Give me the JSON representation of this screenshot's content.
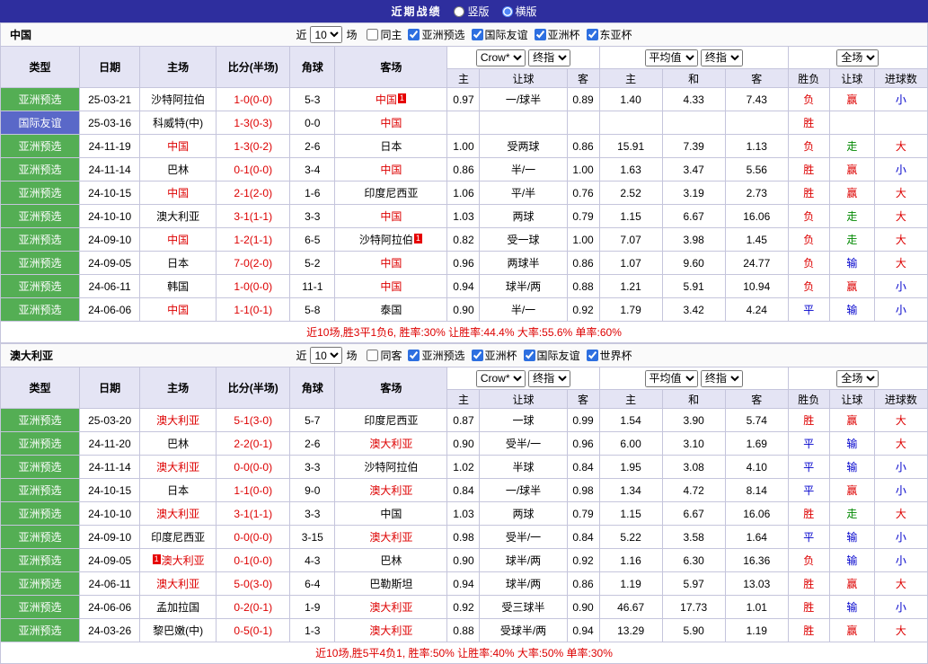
{
  "title_bar": {
    "title": "近期战绩",
    "layout_options": [
      {
        "label": "竖版",
        "selected": false
      },
      {
        "label": "横版",
        "selected": true
      }
    ]
  },
  "table_header": {
    "main_cols": [
      "类型",
      "日期",
      "主场",
      "比分(半场)",
      "角球",
      "客场"
    ],
    "odds_dropdown1": "Crow*",
    "odds_dropdown2": "终指",
    "avg_dropdown1": "平均值",
    "avg_dropdown2": "终指",
    "scope_dropdown": "全场",
    "odds_sub_cols": [
      "主",
      "让球",
      "客"
    ],
    "avg_sub_cols": [
      "主",
      "和",
      "客"
    ],
    "result_sub_cols": [
      "胜负",
      "让球",
      "进球数"
    ]
  },
  "colors": {
    "title_bar_bg": "#2e2e9e",
    "header_bg": "#e4e4f4",
    "type_green": "#54ae54",
    "type_blue": "#5a68c8",
    "red": "#dd0000",
    "blue": "#0000cc",
    "green": "#008800",
    "border": "#c5c5dc"
  },
  "sections": [
    {
      "name": "中国",
      "filter": {
        "near_label": "近",
        "count": "10",
        "unit_label": "场",
        "checkboxes": [
          {
            "label": "同主",
            "checked": false
          },
          {
            "label": "亚洲预选",
            "checked": true
          },
          {
            "label": "国际友谊",
            "checked": true
          },
          {
            "label": "亚洲杯",
            "checked": true
          },
          {
            "label": "东亚杯",
            "checked": true
          }
        ]
      },
      "rows": [
        {
          "type": "亚洲预选",
          "type_style": "green",
          "date": "25-03-21",
          "home": "沙特阿拉伯",
          "home_focus": false,
          "score": "1-0(0-0)",
          "corner": "5-3",
          "away": "中国",
          "away_focus": true,
          "away_card": "1",
          "odds": [
            "0.97",
            "一/球半",
            "0.89"
          ],
          "avg": [
            "1.40",
            "4.33",
            "7.43"
          ],
          "results": [
            "负",
            "赢",
            "小"
          ]
        },
        {
          "type": "国际友谊",
          "type_style": "blue",
          "date": "25-03-16",
          "home": "科威特(中)",
          "home_focus": false,
          "score": "1-3(0-3)",
          "corner": "0-0",
          "away": "中国",
          "away_focus": true,
          "odds": [
            "",
            "",
            ""
          ],
          "avg": [
            "",
            "",
            ""
          ],
          "results": [
            "胜",
            "",
            ""
          ]
        },
        {
          "type": "亚洲预选",
          "type_style": "green",
          "date": "24-11-19",
          "home": "中国",
          "home_focus": true,
          "score": "1-3(0-2)",
          "corner": "2-6",
          "away": "日本",
          "away_focus": false,
          "odds": [
            "1.00",
            "受两球",
            "0.86"
          ],
          "avg": [
            "15.91",
            "7.39",
            "1.13"
          ],
          "results": [
            "负",
            "走",
            "大"
          ]
        },
        {
          "type": "亚洲预选",
          "type_style": "green",
          "date": "24-11-14",
          "home": "巴林",
          "home_focus": false,
          "score": "0-1(0-0)",
          "corner": "3-4",
          "away": "中国",
          "away_focus": true,
          "odds": [
            "0.86",
            "半/一",
            "1.00"
          ],
          "avg": [
            "1.63",
            "3.47",
            "5.56"
          ],
          "results": [
            "胜",
            "赢",
            "小"
          ]
        },
        {
          "type": "亚洲预选",
          "type_style": "green",
          "date": "24-10-15",
          "home": "中国",
          "home_focus": true,
          "score": "2-1(2-0)",
          "corner": "1-6",
          "away": "印度尼西亚",
          "away_focus": false,
          "odds": [
            "1.06",
            "平/半",
            "0.76"
          ],
          "avg": [
            "2.52",
            "3.19",
            "2.73"
          ],
          "results": [
            "胜",
            "赢",
            "大"
          ]
        },
        {
          "type": "亚洲预选",
          "type_style": "green",
          "date": "24-10-10",
          "home": "澳大利亚",
          "home_focus": false,
          "score": "3-1(1-1)",
          "corner": "3-3",
          "away": "中国",
          "away_focus": true,
          "odds": [
            "1.03",
            "两球",
            "0.79"
          ],
          "avg": [
            "1.15",
            "6.67",
            "16.06"
          ],
          "results": [
            "负",
            "走",
            "大"
          ]
        },
        {
          "type": "亚洲预选",
          "type_style": "green",
          "date": "24-09-10",
          "home": "中国",
          "home_focus": true,
          "score": "1-2(1-1)",
          "corner": "6-5",
          "away": "沙特阿拉伯",
          "away_focus": false,
          "away_card": "1",
          "odds": [
            "0.82",
            "受一球",
            "1.00"
          ],
          "avg": [
            "7.07",
            "3.98",
            "1.45"
          ],
          "results": [
            "负",
            "走",
            "大"
          ]
        },
        {
          "type": "亚洲预选",
          "type_style": "green",
          "date": "24-09-05",
          "home": "日本",
          "home_focus": false,
          "score": "7-0(2-0)",
          "corner": "5-2",
          "away": "中国",
          "away_focus": true,
          "odds": [
            "0.96",
            "两球半",
            "0.86"
          ],
          "avg": [
            "1.07",
            "9.60",
            "24.77"
          ],
          "results": [
            "负",
            "输",
            "大"
          ]
        },
        {
          "type": "亚洲预选",
          "type_style": "green",
          "date": "24-06-11",
          "home": "韩国",
          "home_focus": false,
          "score": "1-0(0-0)",
          "corner": "11-1",
          "away": "中国",
          "away_focus": true,
          "odds": [
            "0.94",
            "球半/两",
            "0.88"
          ],
          "avg": [
            "1.21",
            "5.91",
            "10.94"
          ],
          "results": [
            "负",
            "赢",
            "小"
          ]
        },
        {
          "type": "亚洲预选",
          "type_style": "green",
          "date": "24-06-06",
          "home": "中国",
          "home_focus": true,
          "score": "1-1(0-1)",
          "corner": "5-8",
          "away": "泰国",
          "away_focus": false,
          "odds": [
            "0.90",
            "半/一",
            "0.92"
          ],
          "avg": [
            "1.79",
            "3.42",
            "4.24"
          ],
          "results": [
            "平",
            "输",
            "小"
          ]
        }
      ],
      "summary": "近10场,胜3平1负6, 胜率:30% 让胜率:44.4% 大率:55.6% 单率:60%"
    },
    {
      "name": "澳大利亚",
      "filter": {
        "near_label": "近",
        "count": "10",
        "unit_label": "场",
        "checkboxes": [
          {
            "label": "同客",
            "checked": false
          },
          {
            "label": "亚洲预选",
            "checked": true
          },
          {
            "label": "亚洲杯",
            "checked": true
          },
          {
            "label": "国际友谊",
            "checked": true
          },
          {
            "label": "世界杯",
            "checked": true
          }
        ]
      },
      "rows": [
        {
          "type": "亚洲预选",
          "type_style": "green",
          "date": "25-03-20",
          "home": "澳大利亚",
          "home_focus": true,
          "score": "5-1(3-0)",
          "corner": "5-7",
          "away": "印度尼西亚",
          "away_focus": false,
          "odds": [
            "0.87",
            "一球",
            "0.99"
          ],
          "avg": [
            "1.54",
            "3.90",
            "5.74"
          ],
          "results": [
            "胜",
            "赢",
            "大"
          ]
        },
        {
          "type": "亚洲预选",
          "type_style": "green",
          "date": "24-11-20",
          "home": "巴林",
          "home_focus": false,
          "score": "2-2(0-1)",
          "corner": "2-6",
          "away": "澳大利亚",
          "away_focus": true,
          "odds": [
            "0.90",
            "受半/一",
            "0.96"
          ],
          "avg": [
            "6.00",
            "3.10",
            "1.69"
          ],
          "results": [
            "平",
            "输",
            "大"
          ]
        },
        {
          "type": "亚洲预选",
          "type_style": "green",
          "date": "24-11-14",
          "home": "澳大利亚",
          "home_focus": true,
          "score": "0-0(0-0)",
          "corner": "3-3",
          "away": "沙特阿拉伯",
          "away_focus": false,
          "odds": [
            "1.02",
            "半球",
            "0.84"
          ],
          "avg": [
            "1.95",
            "3.08",
            "4.10"
          ],
          "results": [
            "平",
            "输",
            "小"
          ]
        },
        {
          "type": "亚洲预选",
          "type_style": "green",
          "date": "24-10-15",
          "home": "日本",
          "home_focus": false,
          "score": "1-1(0-0)",
          "corner": "9-0",
          "away": "澳大利亚",
          "away_focus": true,
          "odds": [
            "0.84",
            "一/球半",
            "0.98"
          ],
          "avg": [
            "1.34",
            "4.72",
            "8.14"
          ],
          "results": [
            "平",
            "赢",
            "小"
          ]
        },
        {
          "type": "亚洲预选",
          "type_style": "green",
          "date": "24-10-10",
          "home": "澳大利亚",
          "home_focus": true,
          "score": "3-1(1-1)",
          "corner": "3-3",
          "away": "中国",
          "away_focus": false,
          "odds": [
            "1.03",
            "两球",
            "0.79"
          ],
          "avg": [
            "1.15",
            "6.67",
            "16.06"
          ],
          "results": [
            "胜",
            "走",
            "大"
          ]
        },
        {
          "type": "亚洲预选",
          "type_style": "green",
          "date": "24-09-10",
          "home": "印度尼西亚",
          "home_focus": false,
          "score": "0-0(0-0)",
          "corner": "3-15",
          "away": "澳大利亚",
          "away_focus": true,
          "odds": [
            "0.98",
            "受半/一",
            "0.84"
          ],
          "avg": [
            "5.22",
            "3.58",
            "1.64"
          ],
          "results": [
            "平",
            "输",
            "小"
          ]
        },
        {
          "type": "亚洲预选",
          "type_style": "green",
          "date": "24-09-05",
          "home": "澳大利亚",
          "home_focus": true,
          "home_card": "1",
          "home_card_pos": "before",
          "score": "0-1(0-0)",
          "corner": "4-3",
          "away": "巴林",
          "away_focus": false,
          "odds": [
            "0.90",
            "球半/两",
            "0.92"
          ],
          "avg": [
            "1.16",
            "6.30",
            "16.36"
          ],
          "results": [
            "负",
            "输",
            "小"
          ]
        },
        {
          "type": "亚洲预选",
          "type_style": "green",
          "date": "24-06-11",
          "home": "澳大利亚",
          "home_focus": true,
          "score": "5-0(3-0)",
          "corner": "6-4",
          "away": "巴勒斯坦",
          "away_focus": false,
          "odds": [
            "0.94",
            "球半/两",
            "0.86"
          ],
          "avg": [
            "1.19",
            "5.97",
            "13.03"
          ],
          "results": [
            "胜",
            "赢",
            "大"
          ]
        },
        {
          "type": "亚洲预选",
          "type_style": "green",
          "date": "24-06-06",
          "home": "孟加拉国",
          "home_focus": false,
          "score": "0-2(0-1)",
          "corner": "1-9",
          "away": "澳大利亚",
          "away_focus": true,
          "odds": [
            "0.92",
            "受三球半",
            "0.90"
          ],
          "avg": [
            "46.67",
            "17.73",
            "1.01"
          ],
          "results": [
            "胜",
            "输",
            "小"
          ]
        },
        {
          "type": "亚洲预选",
          "type_style": "green",
          "date": "24-03-26",
          "home": "黎巴嫩(中)",
          "home_focus": false,
          "score": "0-5(0-1)",
          "corner": "1-3",
          "away": "澳大利亚",
          "away_focus": true,
          "odds": [
            "0.88",
            "受球半/两",
            "0.94"
          ],
          "avg": [
            "13.29",
            "5.90",
            "1.19"
          ],
          "results": [
            "胜",
            "赢",
            "大"
          ]
        }
      ],
      "summary": "近10场,胜5平4负1, 胜率:50% 让胜率:40% 大率:50% 单率:30%"
    }
  ]
}
